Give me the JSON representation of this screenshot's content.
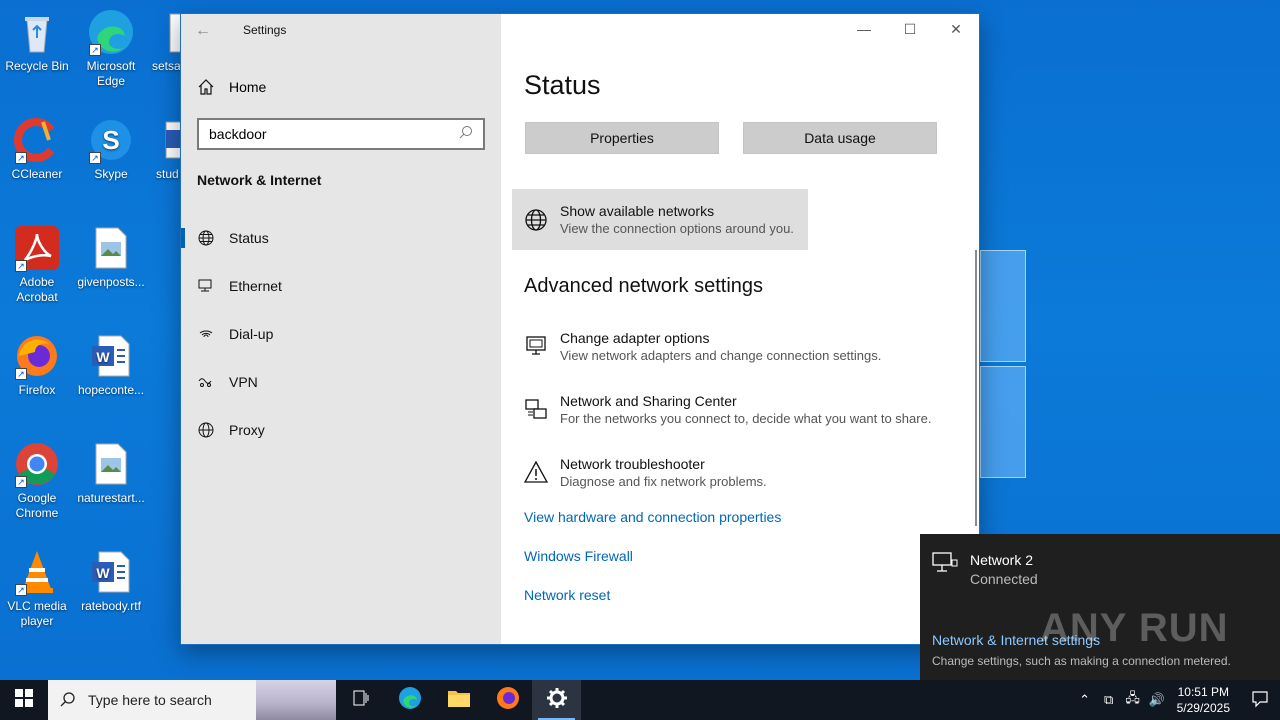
{
  "desktop": {
    "icons": [
      {
        "label": "Recycle Bin",
        "icon": "recycle-bin-icon"
      },
      {
        "label": "Microsoft Edge",
        "icon": "edge-icon"
      },
      {
        "label": "setsa",
        "icon": "file-icon"
      },
      {
        "label": "CCleaner",
        "icon": "ccleaner-icon"
      },
      {
        "label": "Skype",
        "icon": "skype-icon"
      },
      {
        "label": "stud",
        "icon": "word-icon"
      },
      {
        "label": "Adobe Acrobat",
        "icon": "acrobat-icon"
      },
      {
        "label": "givenposts...",
        "icon": "image-file-icon"
      },
      {
        "label": "Firefox",
        "icon": "firefox-icon"
      },
      {
        "label": "hopeconte...",
        "icon": "word-icon"
      },
      {
        "label": "Google Chrome",
        "icon": "chrome-icon"
      },
      {
        "label": "naturestart...",
        "icon": "image-file-icon"
      },
      {
        "label": "VLC media player",
        "icon": "vlc-icon"
      },
      {
        "label": "ratebody.rtf",
        "icon": "word-icon"
      }
    ]
  },
  "window": {
    "title": "Settings",
    "sidebar": {
      "home_label": "Home",
      "search_value": "backdoor",
      "section_title": "Network & Internet",
      "items": [
        {
          "label": "Status",
          "icon": "globe-icon",
          "active": true
        },
        {
          "label": "Ethernet",
          "icon": "ethernet-icon",
          "active": false
        },
        {
          "label": "Dial-up",
          "icon": "dialup-icon",
          "active": false
        },
        {
          "label": "VPN",
          "icon": "vpn-icon",
          "active": false
        },
        {
          "label": "Proxy",
          "icon": "proxy-globe-icon",
          "active": false
        }
      ]
    },
    "main": {
      "title": "Status",
      "buttons": {
        "properties": "Properties",
        "data_usage": "Data usage"
      },
      "show_networks": {
        "title": "Show available networks",
        "subtitle": "View the connection options around you."
      },
      "advanced_title": "Advanced network settings",
      "advanced_items": [
        {
          "title": "Change adapter options",
          "subtitle": "View network adapters and change connection settings.",
          "icon": "adapter-icon"
        },
        {
          "title": "Network and Sharing Center",
          "subtitle": "For the networks you connect to, decide what you want to share.",
          "icon": "sharing-icon"
        },
        {
          "title": "Network troubleshooter",
          "subtitle": "Diagnose and fix network problems.",
          "icon": "warning-icon"
        }
      ],
      "links": {
        "hardware": "View hardware and connection properties",
        "firewall": "Windows Firewall",
        "reset": "Network reset"
      }
    }
  },
  "flyout": {
    "network_name": "Network 2",
    "network_status": "Connected",
    "settings_link": "Network & Internet settings",
    "settings_sub": "Change settings, such as making a connection metered."
  },
  "watermark": "ANY RUN",
  "taskbar": {
    "search_placeholder": "Type here to search",
    "clock_time": "10:51 PM",
    "clock_date": "5/29/2025"
  }
}
